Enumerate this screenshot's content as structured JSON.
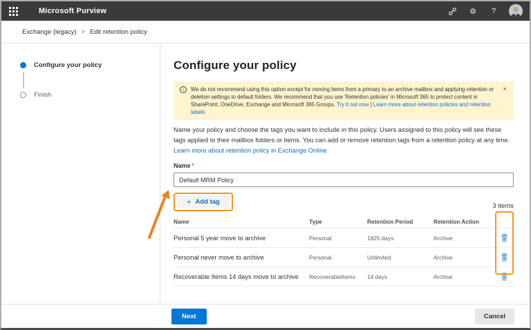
{
  "topbar": {
    "app_title": "Microsoft Purview"
  },
  "icons": {
    "settings_glyph": "⚙",
    "help_glyph": "?",
    "close_glyph": "×",
    "info_glyph": "i",
    "plus_glyph": "+",
    "breadcrumb_separator": ">"
  },
  "breadcrumb": {
    "parent": "Exchange (legacy)",
    "current": "Edit retention policy"
  },
  "stepper": {
    "steps": [
      {
        "label": "Configure your policy",
        "state": "active"
      },
      {
        "label": "Finish",
        "state": "pending"
      }
    ]
  },
  "main": {
    "title": "Configure your policy",
    "banner": {
      "text": "We do not recommend using this option except for moving items from a primary to an archive mailbox and applying retention or deletion settings to default folders. We recommend that you use 'Retention policies' in Microsoft 365 to protect content in SharePoint, OneDrive, Exchange and Microsoft 365 Groups. ",
      "link1": "Try it out now",
      "link_separator": " | ",
      "link2": "Learn more about retention policies and retention labels"
    },
    "description": "Name your policy and choose the tags you want to include in this policy. Users assigned to this policy will see these tags applied to their mailbox folders or items. You can add or remove retention tags from a retention policy at any time. ",
    "description_link": "Learn more about retention policy in Exchange Online",
    "name_field": {
      "label": "Name",
      "required_mark": "*",
      "value": "Default MRM Policy"
    },
    "add_tag_label": "Add tag",
    "items_count": "3 items",
    "table": {
      "headers": [
        "Name",
        "Type",
        "Retention Period",
        "Retention Action"
      ],
      "rows": [
        {
          "name": "Personal 5 year move to archive",
          "type": "Personal",
          "retention_period": "1825 days",
          "retention_action": "Archive"
        },
        {
          "name": "Personal never move to archive",
          "type": "Personal",
          "retention_period": "Unlimited",
          "retention_action": "Archive"
        },
        {
          "name": "Recoverable Items 14 days move to archive",
          "type": "RecoverableItems",
          "retention_period": "14 days",
          "retention_action": "Archive"
        }
      ]
    }
  },
  "footer": {
    "next_label": "Next",
    "cancel_label": "Cancel"
  },
  "colors": {
    "accent": "#0078d4",
    "annotation_orange": "#f7941d",
    "banner_bg": "#fff4ce",
    "topbar_bg": "#3a393c",
    "link": "#0e6fc8"
  }
}
